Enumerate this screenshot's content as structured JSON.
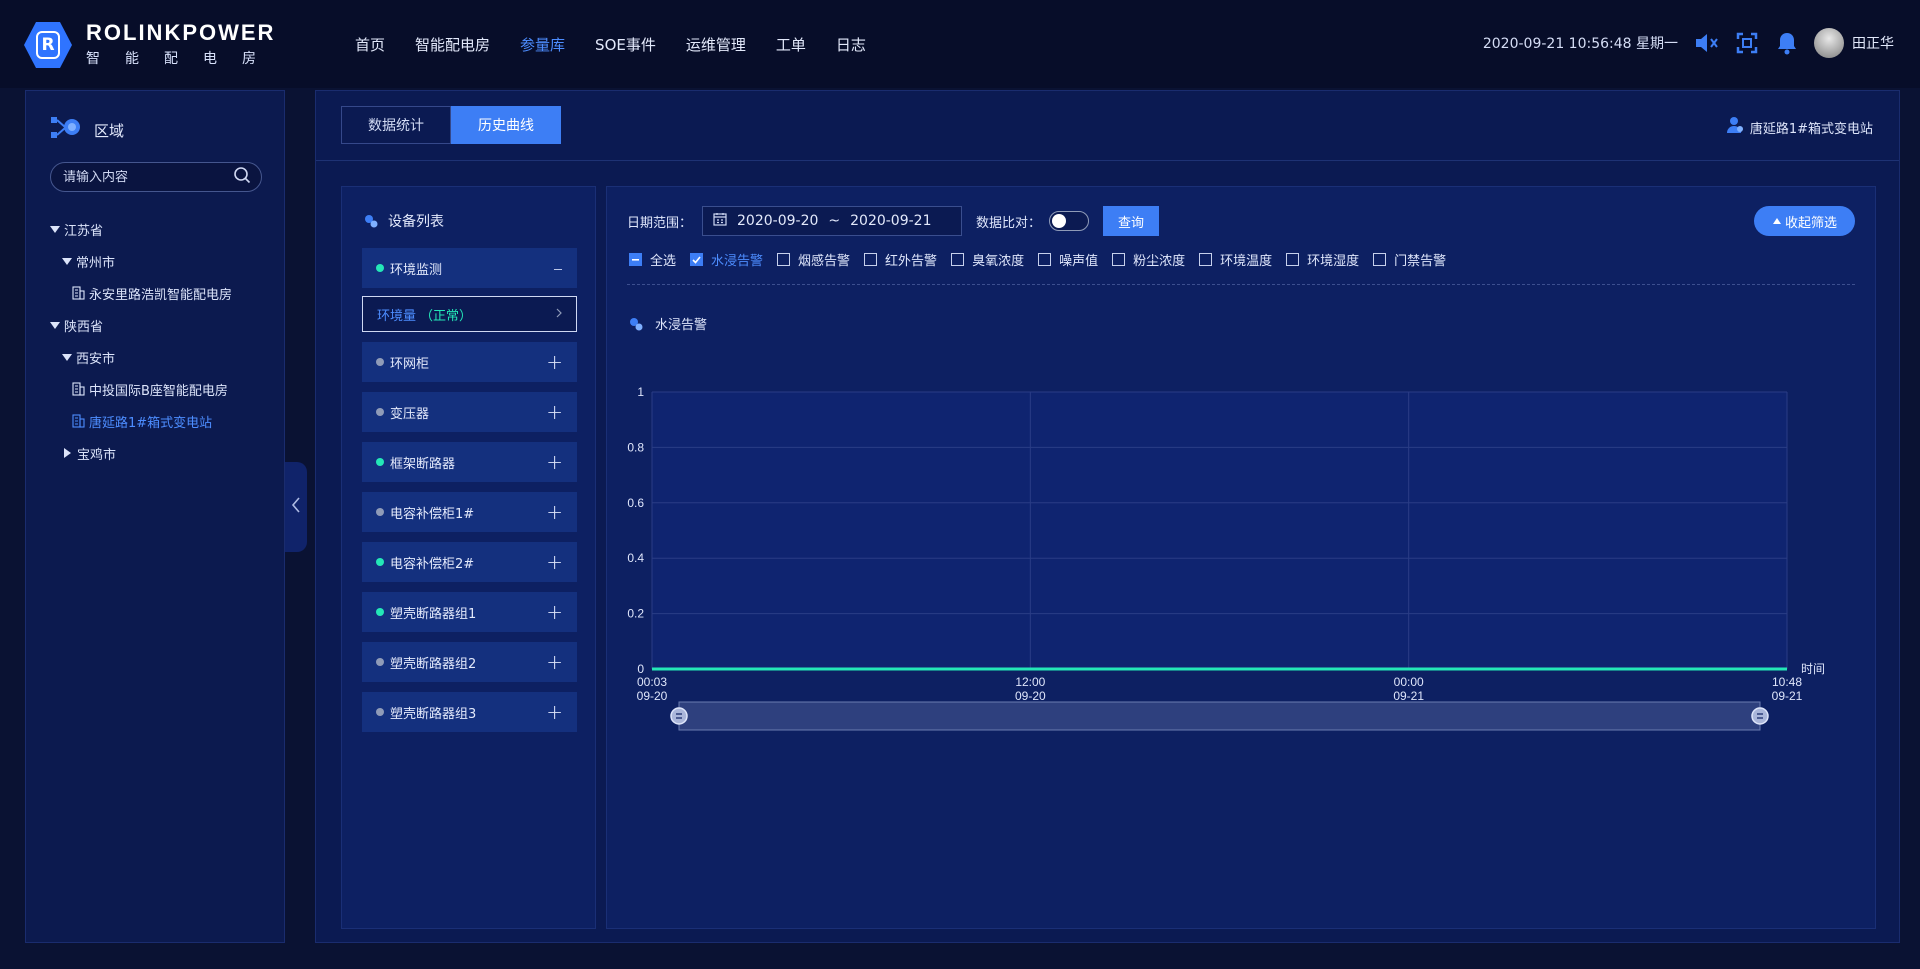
{
  "brand": {
    "name": "ROLINKPOWER",
    "sub": "智能配电房",
    "logo_letter": "R"
  },
  "nav": [
    {
      "label": "首页",
      "active": false
    },
    {
      "label": "智能配电房",
      "active": false
    },
    {
      "label": "参量库",
      "active": true
    },
    {
      "label": "SOE事件",
      "active": false
    },
    {
      "label": "运维管理",
      "active": false
    },
    {
      "label": "工单",
      "active": false
    },
    {
      "label": "日志",
      "active": false
    }
  ],
  "header": {
    "datetime": "2020-09-21 10:56:48 星期一",
    "username": "田正华"
  },
  "sidebar": {
    "title": "区域",
    "search_placeholder": "请输入内容",
    "tree": [
      {
        "label": "江苏省",
        "level": 0,
        "caret": "down"
      },
      {
        "label": "常州市",
        "level": 1,
        "caret": "down"
      },
      {
        "label": "永安里路浩凯智能配电房",
        "level": 2,
        "caret": "leaf"
      },
      {
        "label": "陕西省",
        "level": 0,
        "caret": "down"
      },
      {
        "label": "西安市",
        "level": 1,
        "caret": "down"
      },
      {
        "label": "中投国际B座智能配电房",
        "level": 2,
        "caret": "leaf"
      },
      {
        "label": "唐延路1#箱式变电站",
        "level": 2,
        "caret": "leaf",
        "selected": true
      },
      {
        "label": "宝鸡市",
        "level": 1,
        "caret": "right"
      }
    ]
  },
  "tabs": [
    {
      "label": "数据统计",
      "active": false
    },
    {
      "label": "历史曲线",
      "active": true
    }
  ],
  "station": "唐延路1#箱式变电站",
  "devices": {
    "title": "设备列表",
    "items": [
      {
        "label": "环境监测",
        "online": true,
        "expanded": true,
        "sub": {
          "label": "环境量",
          "status": "（正常）"
        }
      },
      {
        "label": "环网柜",
        "online": false,
        "expanded": false
      },
      {
        "label": "变压器",
        "online": false,
        "expanded": false
      },
      {
        "label": "框架断路器",
        "online": true,
        "expanded": false
      },
      {
        "label": "电容补偿柜1#",
        "online": false,
        "expanded": false
      },
      {
        "label": "电容补偿柜2#",
        "online": true,
        "expanded": false
      },
      {
        "label": "塑壳断路器组1",
        "online": true,
        "expanded": false
      },
      {
        "label": "塑壳断路器组2",
        "online": false,
        "expanded": false
      },
      {
        "label": "塑壳断路器组3",
        "online": false,
        "expanded": false
      }
    ]
  },
  "filters": {
    "date_label": "日期范围：",
    "date_start": "2020-09-20",
    "date_sep": "~",
    "date_end": "2020-09-21",
    "compare_label": "数据比对：",
    "compare_on": false,
    "query_label": "查询",
    "collapse_label": "收起筛选",
    "checkboxes": [
      {
        "label": "全选",
        "state": "partial"
      },
      {
        "label": "水浸告警",
        "state": "checked"
      },
      {
        "label": "烟感告警",
        "state": "unchecked"
      },
      {
        "label": "红外告警",
        "state": "unchecked"
      },
      {
        "label": "臭氧浓度",
        "state": "unchecked"
      },
      {
        "label": "噪声值",
        "state": "unchecked"
      },
      {
        "label": "粉尘浓度",
        "state": "unchecked"
      },
      {
        "label": "环境温度",
        "state": "unchecked"
      },
      {
        "label": "环境湿度",
        "state": "unchecked"
      },
      {
        "label": "门禁告警",
        "state": "unchecked"
      }
    ]
  },
  "chart_data": {
    "type": "line",
    "title": "水浸告警",
    "xlabel": "时间",
    "ylabel": "",
    "ylim": [
      0,
      1
    ],
    "yticks": [
      "0",
      "0.2",
      "0.4",
      "0.6",
      "0.8",
      "1"
    ],
    "xticks": [
      {
        "time": "00:03",
        "date": "09-20"
      },
      {
        "time": "12:00",
        "date": "09-20"
      },
      {
        "time": "00:00",
        "date": "09-21"
      },
      {
        "time": "10:48",
        "date": "09-21"
      }
    ],
    "grid": true,
    "series": [
      {
        "color": "#24e7b7",
        "x": [
          "09-20 00:03",
          "09-21 10:48"
        ],
        "values": [
          0,
          0
        ]
      }
    ]
  }
}
